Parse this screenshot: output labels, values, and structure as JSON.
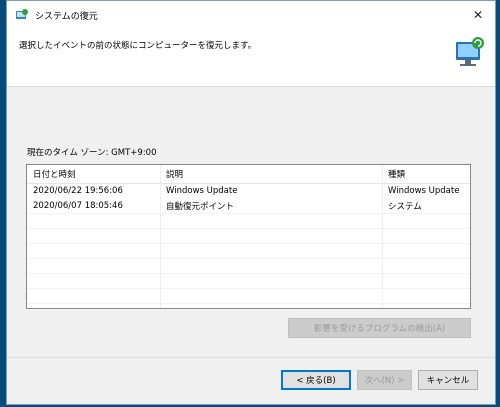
{
  "window": {
    "title": "システムの復元",
    "close_glyph": "✕"
  },
  "header": {
    "instruction": "選択したイベントの前の状態にコンピューターを復元します。"
  },
  "timezone_label": "現在のタイム ゾーン: GMT+9:00",
  "table": {
    "columns": [
      "日付と時刻",
      "説明",
      "種類"
    ],
    "sort_glyph": "ˇ",
    "rows": [
      [
        "2020/06/22 19:56:06",
        "Windows Update",
        "Windows Update"
      ],
      [
        "2020/06/07 18:05:46",
        "自動復元ポイント",
        "システム"
      ]
    ]
  },
  "buttons": {
    "scan": "影響を受けるプログラムの検出(A)",
    "back": "< 戻る(B)",
    "next": "次へ(N) >",
    "cancel": "キャンセル"
  },
  "colors": {
    "accent": "#0078d7",
    "desktop": "#0a4a78"
  }
}
